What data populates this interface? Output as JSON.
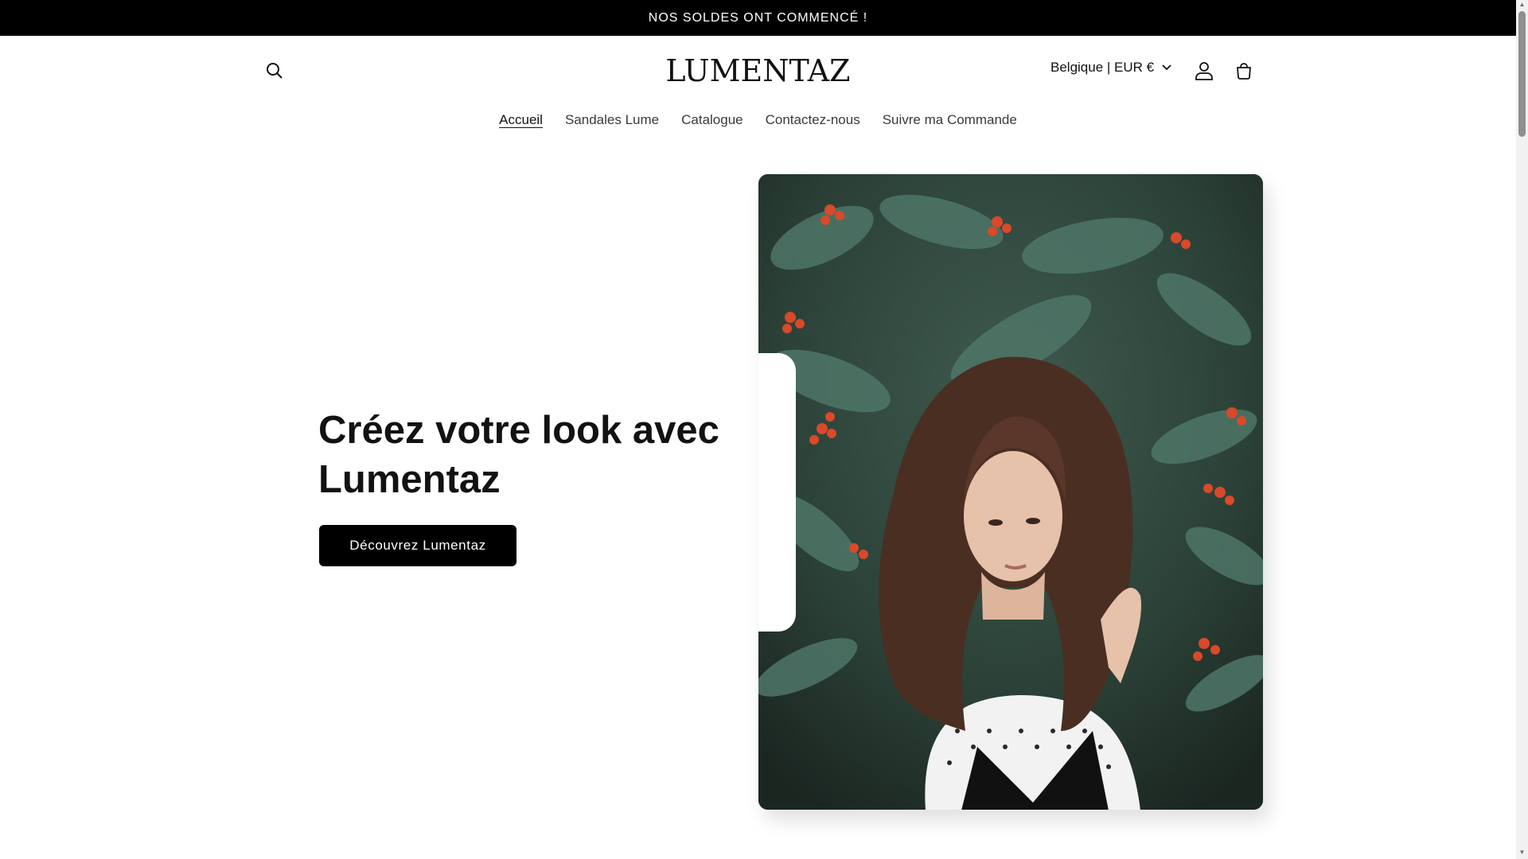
{
  "announcement": {
    "text": "NOS SOLDES ONT COMMENCÉ !"
  },
  "header": {
    "logo": "LUMENTAZ",
    "localization": "Belgique | EUR €",
    "icons": {
      "search": "search-icon",
      "account": "user-icon",
      "cart": "cart-icon",
      "dropdown": "chevron-down-icon"
    }
  },
  "nav": {
    "items": [
      {
        "label": "Accueil",
        "active": true
      },
      {
        "label": "Sandales Lume"
      },
      {
        "label": "Catalogue"
      },
      {
        "label": "Contactez-nous"
      },
      {
        "label": "Suivre ma Commande"
      }
    ]
  },
  "hero": {
    "heading_line1": "Créez votre look avec",
    "heading_line2": "Lumentaz",
    "button_label": "Découvrez Lumentaz",
    "image": "woman-with-curly-hair-photo"
  },
  "colors": {
    "announcement_bg": "#000000",
    "button_bg": "#000000",
    "text": "#121212"
  }
}
